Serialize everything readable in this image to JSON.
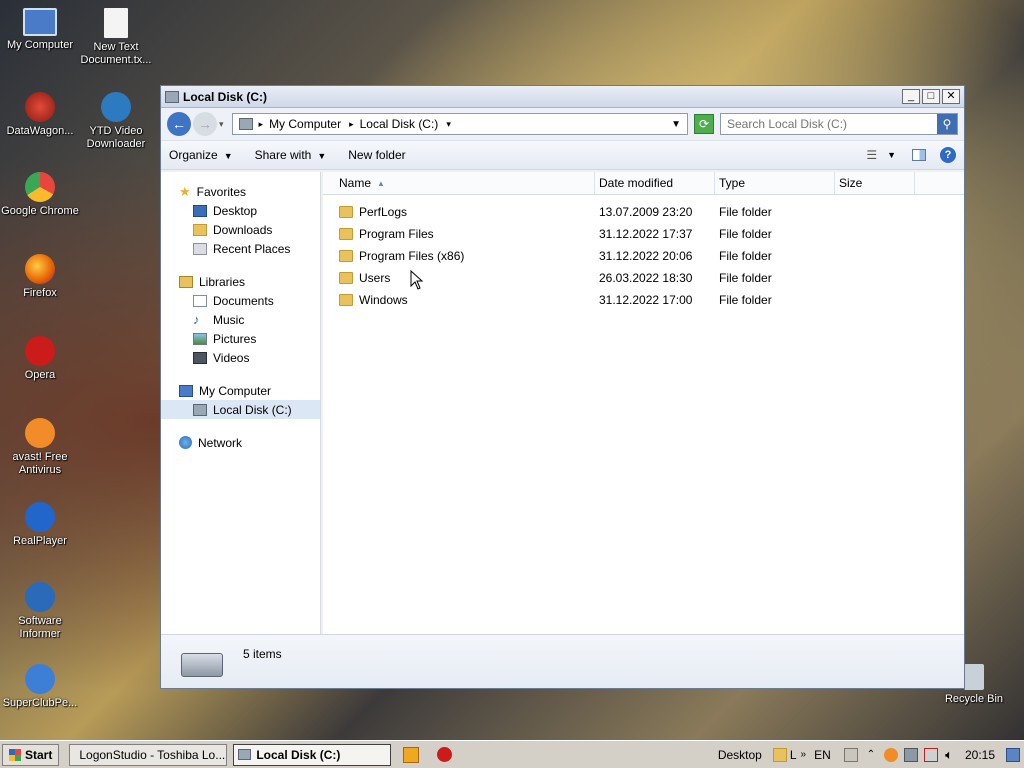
{
  "desktop": {
    "icons": [
      {
        "label": "My Computer",
        "icon": "computer-icon",
        "color": "#4a7bc8"
      },
      {
        "label": "New Text Document.tx...",
        "icon": "text-file-icon",
        "color": "#f4f4f4"
      },
      {
        "label": "DataWagon...",
        "icon": "datawagon-icon",
        "color": "#c0392b"
      },
      {
        "label": "YTD Video Downloader",
        "icon": "ytd-icon",
        "color": "#2c7ac0"
      },
      {
        "label": "Google Chrome",
        "icon": "chrome-icon",
        "color": "#e8453c"
      },
      {
        "label": "Firefox",
        "icon": "firefox-icon",
        "color": "#e66000"
      },
      {
        "label": "Opera",
        "icon": "opera-icon",
        "color": "#cc1b1b"
      },
      {
        "label": "avast! Free Antivirus",
        "icon": "avast-icon",
        "color": "#f28c28"
      },
      {
        "label": "RealPlayer",
        "icon": "realplayer-icon",
        "color": "#2266cc"
      },
      {
        "label": "Software Informer",
        "icon": "software-informer-icon",
        "color": "#2a6ab8"
      },
      {
        "label": "SuperClubPe...",
        "icon": "superclub-icon",
        "color": "#3d7fd6"
      },
      {
        "label": "Recycle Bin",
        "icon": "recycle-bin-icon",
        "color": "#c8d0d8"
      }
    ]
  },
  "window": {
    "title": "Local Disk (C:)",
    "address": {
      "crumbs": [
        "My Computer",
        "Local Disk (C:)"
      ]
    },
    "search_placeholder": "Search Local Disk (C:)",
    "toolbar": {
      "organize": "Organize",
      "share_with": "Share with",
      "new_folder": "New folder"
    },
    "nav": {
      "favorites": "Favorites",
      "favorites_items": [
        "Desktop",
        "Downloads",
        "Recent Places"
      ],
      "libraries": "Libraries",
      "libraries_items": [
        "Documents",
        "Music",
        "Pictures",
        "Videos"
      ],
      "my_computer": "My Computer",
      "my_computer_items": [
        "Local Disk (C:)"
      ],
      "network": "Network"
    },
    "columns": {
      "name": "Name",
      "date": "Date modified",
      "type": "Type",
      "size": "Size"
    },
    "rows": [
      {
        "name": "PerfLogs",
        "date": "13.07.2009 23:20",
        "type": "File folder",
        "size": ""
      },
      {
        "name": "Program Files",
        "date": "31.12.2022 17:37",
        "type": "File folder",
        "size": ""
      },
      {
        "name": "Program Files (x86)",
        "date": "31.12.2022 20:06",
        "type": "File folder",
        "size": ""
      },
      {
        "name": "Users",
        "date": "26.03.2022 18:30",
        "type": "File folder",
        "size": ""
      },
      {
        "name": "Windows",
        "date": "31.12.2022 17:00",
        "type": "File folder",
        "size": ""
      }
    ],
    "status": "5 items"
  },
  "taskbar": {
    "start": "Start",
    "tasks": [
      {
        "label": "LogonStudio - Toshiba Lo...",
        "active": false
      },
      {
        "label": "Local Disk (C:)",
        "active": true
      }
    ],
    "desktop_label": "Desktop",
    "lang": "EN",
    "clock": "20:15"
  },
  "colors": {
    "accent": "#3f6fb0",
    "folder": "#e8c25e",
    "selection": "#dce7f5"
  }
}
